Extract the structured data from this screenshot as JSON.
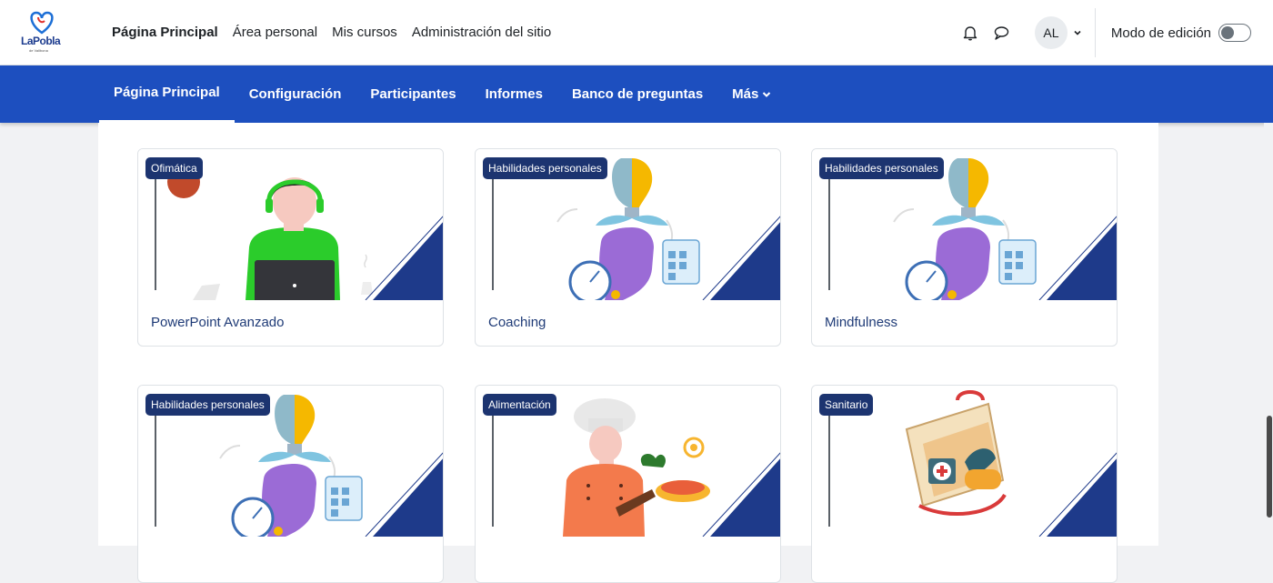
{
  "logo": {
    "text": "LaPobla",
    "subtext": "de Vallbona"
  },
  "topnav": {
    "items": [
      {
        "label": "Página Principal",
        "active": true
      },
      {
        "label": "Área personal",
        "active": false
      },
      {
        "label": "Mis cursos",
        "active": false
      },
      {
        "label": "Administración del sitio",
        "active": false
      }
    ]
  },
  "user": {
    "initials": "AL"
  },
  "edit_mode": {
    "label": "Modo de edición",
    "enabled": false
  },
  "secnav": {
    "items": [
      {
        "label": "Página Principal",
        "active": true
      },
      {
        "label": "Configuración",
        "active": false
      },
      {
        "label": "Participantes",
        "active": false
      },
      {
        "label": "Informes",
        "active": false
      },
      {
        "label": "Banco de preguntas",
        "active": false
      },
      {
        "label": "Más",
        "active": false
      }
    ]
  },
  "courses": [
    {
      "category": "Ofimática",
      "title": "PowerPoint Avanzado",
      "image": "person-laptop"
    },
    {
      "category": "Habilidades personales",
      "title": "Coaching",
      "image": "head-lightbulb"
    },
    {
      "category": "Habilidades personales",
      "title": "Mindfulness",
      "image": "head-lightbulb"
    },
    {
      "category": "Habilidades personales",
      "title": "",
      "image": "head-lightbulb"
    },
    {
      "category": "Alimentación",
      "title": "",
      "image": "chef"
    },
    {
      "category": "Sanitario",
      "title": "",
      "image": "first-aid-kit"
    }
  ],
  "colors": {
    "primary_nav": "#1d4fbf",
    "badge": "#1c3470",
    "corner": "#1e3a8a",
    "title": "#1f3b77"
  }
}
